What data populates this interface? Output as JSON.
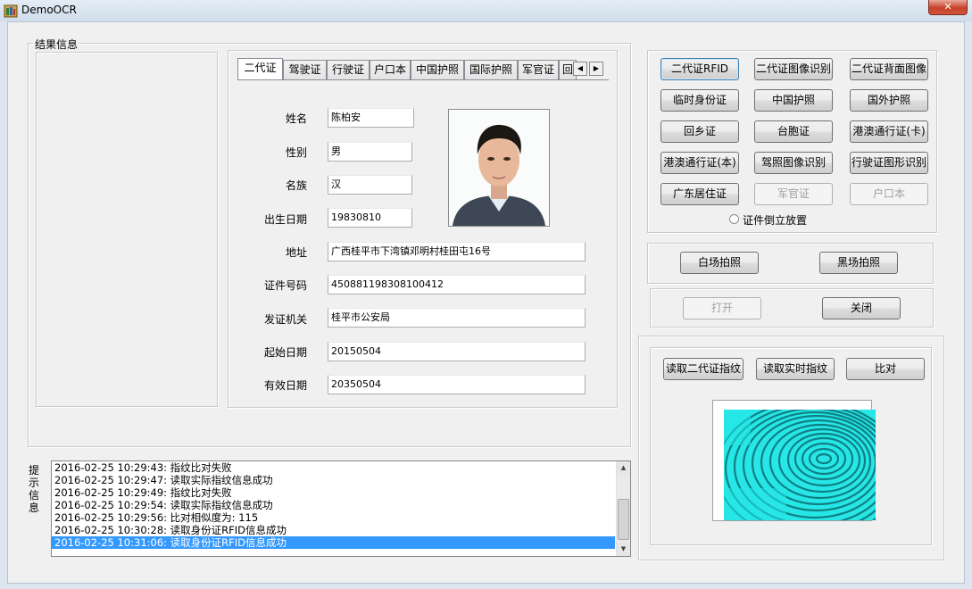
{
  "window": {
    "title": "DemoOCR",
    "close_glyph": "✕"
  },
  "result_group": {
    "legend": "结果信息",
    "tabs": [
      {
        "label": "二代证",
        "active": true
      },
      {
        "label": "驾驶证"
      },
      {
        "label": "行驶证"
      },
      {
        "label": "户口本"
      },
      {
        "label": "中国护照"
      },
      {
        "label": "国际护照"
      },
      {
        "label": "军官证"
      },
      {
        "label": "回"
      }
    ],
    "tab_scroll": {
      "left": "◀",
      "right": "▶"
    },
    "fields": [
      {
        "label": "姓名",
        "value": "陈柏安"
      },
      {
        "label": "性别",
        "value": "男"
      },
      {
        "label": "名族",
        "value": "汉"
      },
      {
        "label": "出生日期",
        "value": "19830810"
      },
      {
        "label": "地址",
        "value": "广西桂平市下湾镇邓明村桂田屯16号"
      },
      {
        "label": "证件号码",
        "value": "450881198308100412"
      },
      {
        "label": "发证机关",
        "value": "桂平市公安局"
      },
      {
        "label": "起始日期",
        "value": "20150504"
      },
      {
        "label": "有效日期",
        "value": "20350504"
      }
    ]
  },
  "doc_buttons": {
    "row1": [
      "二代证RFID",
      "二代证图像识别",
      "二代证背面图像"
    ],
    "row2": [
      "临时身份证",
      "中国护照",
      "国外护照"
    ],
    "row3": [
      "回乡证",
      "台胞证",
      "港澳通行证(卡)"
    ],
    "row4": [
      "港澳通行证(本)",
      "驾照图像识别",
      "行驶证图形识别"
    ],
    "row5": [
      "广东居住证",
      "军官证",
      "户口本"
    ],
    "upside_down_label": "证件倒立放置"
  },
  "light_buttons": {
    "white": "白场拍照",
    "black": "黑场拍照"
  },
  "device_buttons": {
    "open": "打开",
    "close": "关闭"
  },
  "finger_buttons": {
    "read_id": "读取二代证指纹",
    "read_live": "读取实时指纹",
    "compare": "比对"
  },
  "hint": {
    "label": "提示信息",
    "log": [
      "2016-02-25 10:29:43: 指纹比对失败",
      "2016-02-25 10:29:47: 读取实际指纹信息成功",
      "2016-02-25 10:29:49: 指纹比对失败",
      "2016-02-25 10:29:54: 读取实际指纹信息成功",
      "2016-02-25 10:29:56: 比对相似度为: 115",
      "2016-02-25 10:30:28: 读取身份证RFID信息成功",
      "2016-02-25 10:31:06: 读取身份证RFID信息成功"
    ],
    "selected_index": 6
  },
  "icons": {
    "app": "app-icon",
    "portrait": "portrait-photo",
    "fingerprint": "fingerprint-image"
  },
  "colors": {
    "selection": "#3399ff",
    "fingerprint_bg": "#24e4e4",
    "window_frame": "#dde6f0"
  }
}
